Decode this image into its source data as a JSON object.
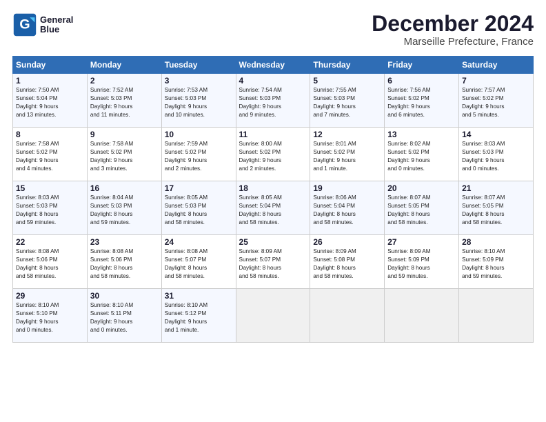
{
  "logo": {
    "line1": "General",
    "line2": "Blue"
  },
  "title": "December 2024",
  "subtitle": "Marseille Prefecture, France",
  "days_header": [
    "Sunday",
    "Monday",
    "Tuesday",
    "Wednesday",
    "Thursday",
    "Friday",
    "Saturday"
  ],
  "weeks": [
    [
      {
        "day": 1,
        "info": "Sunrise: 7:50 AM\nSunset: 5:04 PM\nDaylight: 9 hours\nand 13 minutes."
      },
      {
        "day": 2,
        "info": "Sunrise: 7:52 AM\nSunset: 5:03 PM\nDaylight: 9 hours\nand 11 minutes."
      },
      {
        "day": 3,
        "info": "Sunrise: 7:53 AM\nSunset: 5:03 PM\nDaylight: 9 hours\nand 10 minutes."
      },
      {
        "day": 4,
        "info": "Sunrise: 7:54 AM\nSunset: 5:03 PM\nDaylight: 9 hours\nand 9 minutes."
      },
      {
        "day": 5,
        "info": "Sunrise: 7:55 AM\nSunset: 5:03 PM\nDaylight: 9 hours\nand 7 minutes."
      },
      {
        "day": 6,
        "info": "Sunrise: 7:56 AM\nSunset: 5:02 PM\nDaylight: 9 hours\nand 6 minutes."
      },
      {
        "day": 7,
        "info": "Sunrise: 7:57 AM\nSunset: 5:02 PM\nDaylight: 9 hours\nand 5 minutes."
      }
    ],
    [
      {
        "day": 8,
        "info": "Sunrise: 7:58 AM\nSunset: 5:02 PM\nDaylight: 9 hours\nand 4 minutes."
      },
      {
        "day": 9,
        "info": "Sunrise: 7:58 AM\nSunset: 5:02 PM\nDaylight: 9 hours\nand 3 minutes."
      },
      {
        "day": 10,
        "info": "Sunrise: 7:59 AM\nSunset: 5:02 PM\nDaylight: 9 hours\nand 2 minutes."
      },
      {
        "day": 11,
        "info": "Sunrise: 8:00 AM\nSunset: 5:02 PM\nDaylight: 9 hours\nand 2 minutes."
      },
      {
        "day": 12,
        "info": "Sunrise: 8:01 AM\nSunset: 5:02 PM\nDaylight: 9 hours\nand 1 minute."
      },
      {
        "day": 13,
        "info": "Sunrise: 8:02 AM\nSunset: 5:02 PM\nDaylight: 9 hours\nand 0 minutes."
      },
      {
        "day": 14,
        "info": "Sunrise: 8:03 AM\nSunset: 5:03 PM\nDaylight: 9 hours\nand 0 minutes."
      }
    ],
    [
      {
        "day": 15,
        "info": "Sunrise: 8:03 AM\nSunset: 5:03 PM\nDaylight: 8 hours\nand 59 minutes."
      },
      {
        "day": 16,
        "info": "Sunrise: 8:04 AM\nSunset: 5:03 PM\nDaylight: 8 hours\nand 59 minutes."
      },
      {
        "day": 17,
        "info": "Sunrise: 8:05 AM\nSunset: 5:03 PM\nDaylight: 8 hours\nand 58 minutes."
      },
      {
        "day": 18,
        "info": "Sunrise: 8:05 AM\nSunset: 5:04 PM\nDaylight: 8 hours\nand 58 minutes."
      },
      {
        "day": 19,
        "info": "Sunrise: 8:06 AM\nSunset: 5:04 PM\nDaylight: 8 hours\nand 58 minutes."
      },
      {
        "day": 20,
        "info": "Sunrise: 8:07 AM\nSunset: 5:05 PM\nDaylight: 8 hours\nand 58 minutes."
      },
      {
        "day": 21,
        "info": "Sunrise: 8:07 AM\nSunset: 5:05 PM\nDaylight: 8 hours\nand 58 minutes."
      }
    ],
    [
      {
        "day": 22,
        "info": "Sunrise: 8:08 AM\nSunset: 5:06 PM\nDaylight: 8 hours\nand 58 minutes."
      },
      {
        "day": 23,
        "info": "Sunrise: 8:08 AM\nSunset: 5:06 PM\nDaylight: 8 hours\nand 58 minutes."
      },
      {
        "day": 24,
        "info": "Sunrise: 8:08 AM\nSunset: 5:07 PM\nDaylight: 8 hours\nand 58 minutes."
      },
      {
        "day": 25,
        "info": "Sunrise: 8:09 AM\nSunset: 5:07 PM\nDaylight: 8 hours\nand 58 minutes."
      },
      {
        "day": 26,
        "info": "Sunrise: 8:09 AM\nSunset: 5:08 PM\nDaylight: 8 hours\nand 58 minutes."
      },
      {
        "day": 27,
        "info": "Sunrise: 8:09 AM\nSunset: 5:09 PM\nDaylight: 8 hours\nand 59 minutes."
      },
      {
        "day": 28,
        "info": "Sunrise: 8:10 AM\nSunset: 5:09 PM\nDaylight: 8 hours\nand 59 minutes."
      }
    ],
    [
      {
        "day": 29,
        "info": "Sunrise: 8:10 AM\nSunset: 5:10 PM\nDaylight: 9 hours\nand 0 minutes."
      },
      {
        "day": 30,
        "info": "Sunrise: 8:10 AM\nSunset: 5:11 PM\nDaylight: 9 hours\nand 0 minutes."
      },
      {
        "day": 31,
        "info": "Sunrise: 8:10 AM\nSunset: 5:12 PM\nDaylight: 9 hours\nand 1 minute."
      },
      null,
      null,
      null,
      null
    ]
  ]
}
